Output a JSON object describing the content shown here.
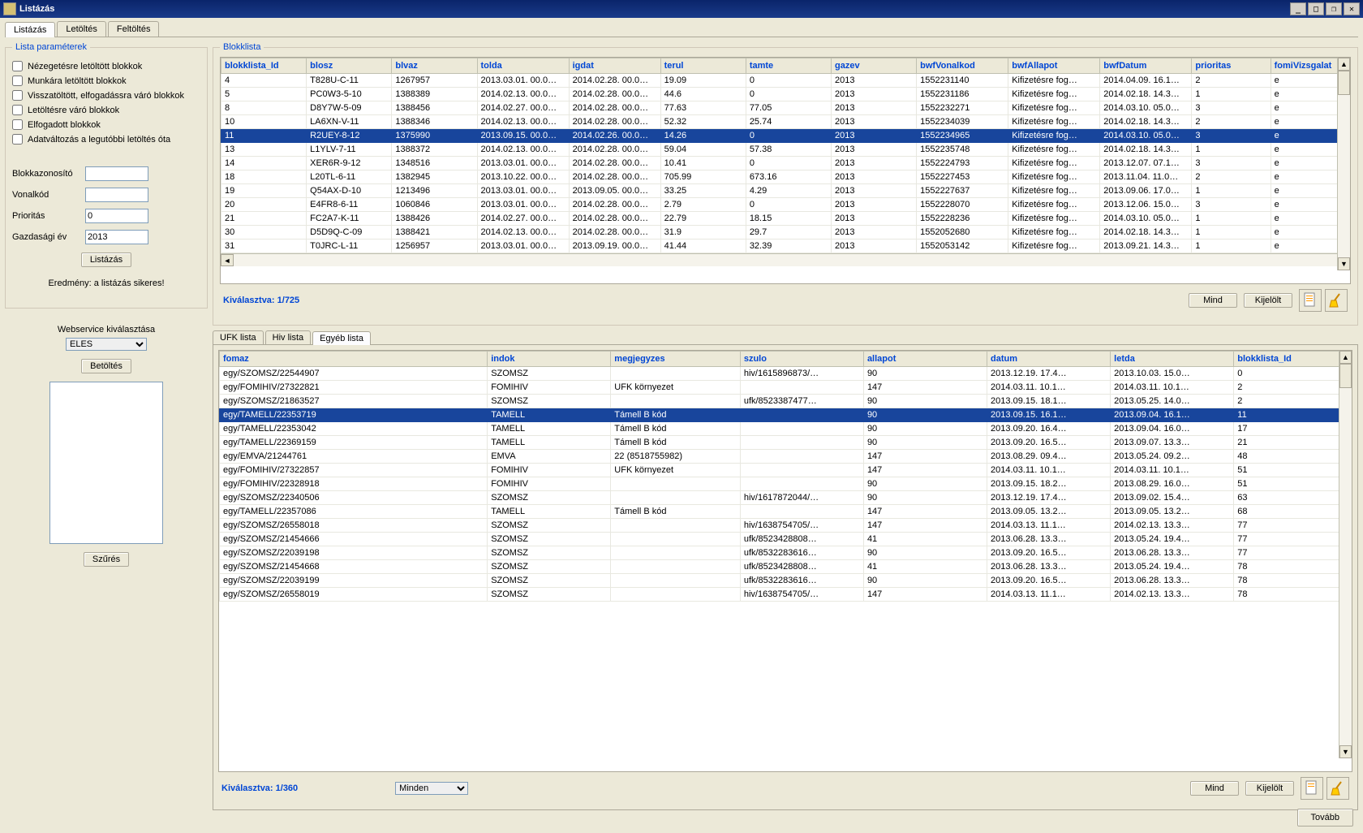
{
  "window": {
    "title": "Listázás",
    "min": "_",
    "max": "□",
    "restore": "❐",
    "close": "✕"
  },
  "mainTabs": [
    "Listázás",
    "Letöltés",
    "Feltöltés"
  ],
  "paramsLegend": "Lista paraméterek",
  "checkboxes": [
    "Nézegetésre letöltött blokkok",
    "Munkára letöltött blokkok",
    "Visszatöltött, elfogadássra váró blokkok",
    "Letöltésre váró blokkok",
    "Elfogadott blokkok",
    "Adatváltozás a legutóbbi letöltés óta"
  ],
  "fields": {
    "blokkazonosito": "Blokkazonosító",
    "vonalkod": "Vonalkód",
    "prioritas": "Prioritás",
    "prioritas_val": "0",
    "gazdev": "Gazdasági év",
    "gazdev_val": "2013"
  },
  "listBtn": "Listázás",
  "statusText": "Eredmény: a listázás sikeres!",
  "wsLabel": "Webservice kiválasztása",
  "wsValue": "ELES",
  "loadBtn": "Betöltés",
  "filterBtn": "Szűrés",
  "blokklistaLegend": "Blokklista",
  "blokkHeaders": [
    "blokklista_Id",
    "blosz",
    "blvaz",
    "tolda",
    "igdat",
    "terul",
    "tamte",
    "gazev",
    "bwfVonalkod",
    "bwfAllapot",
    "bwfDatum",
    "prioritas",
    "fomiVizsgalat"
  ],
  "blokkRows": [
    [
      "4",
      "T828U-C-11",
      "1267957",
      "2013.03.01. 00.0…",
      "2014.02.28. 00.0…",
      "19.09",
      "0",
      "2013",
      "1552231140",
      "Kifizetésre fog…",
      "2014.04.09. 16.1…",
      "2",
      "e"
    ],
    [
      "5",
      "PC0W3-5-10",
      "1388389",
      "2014.02.13. 00.0…",
      "2014.02.28. 00.0…",
      "44.6",
      "0",
      "2013",
      "1552231186",
      "Kifizetésre fog…",
      "2014.02.18. 14.3…",
      "1",
      "e"
    ],
    [
      "8",
      "D8Y7W-5-09",
      "1388456",
      "2014.02.27. 00.0…",
      "2014.02.28. 00.0…",
      "77.63",
      "77.05",
      "2013",
      "1552232271",
      "Kifizetésre fog…",
      "2014.03.10. 05.0…",
      "3",
      "e"
    ],
    [
      "10",
      "LA6XN-V-11",
      "1388346",
      "2014.02.13. 00.0…",
      "2014.02.28. 00.0…",
      "52.32",
      "25.74",
      "2013",
      "1552234039",
      "Kifizetésre fog…",
      "2014.02.18. 14.3…",
      "2",
      "e"
    ],
    [
      "11",
      "R2UEY-8-12",
      "1375990",
      "2013.09.15. 00.0…",
      "2014.02.26. 00.0…",
      "14.26",
      "0",
      "2013",
      "1552234965",
      "Kifizetésre fog…",
      "2014.03.10. 05.0…",
      "3",
      "e"
    ],
    [
      "13",
      "L1YLV-7-11",
      "1388372",
      "2014.02.13. 00.0…",
      "2014.02.28. 00.0…",
      "59.04",
      "57.38",
      "2013",
      "1552235748",
      "Kifizetésre fog…",
      "2014.02.18. 14.3…",
      "1",
      "e"
    ],
    [
      "14",
      "XER6R-9-12",
      "1348516",
      "2013.03.01. 00.0…",
      "2014.02.28. 00.0…",
      "10.41",
      "0",
      "2013",
      "1552224793",
      "Kifizetésre fog…",
      "2013.12.07. 07.1…",
      "3",
      "e"
    ],
    [
      "18",
      "L20TL-6-11",
      "1382945",
      "2013.10.22. 00.0…",
      "2014.02.28. 00.0…",
      "705.99",
      "673.16",
      "2013",
      "1552227453",
      "Kifizetésre fog…",
      "2013.11.04. 11.0…",
      "2",
      "e"
    ],
    [
      "19",
      "Q54AX-D-10",
      "1213496",
      "2013.03.01. 00.0…",
      "2013.09.05. 00.0…",
      "33.25",
      "4.29",
      "2013",
      "1552227637",
      "Kifizetésre fog…",
      "2013.09.06. 17.0…",
      "1",
      "e"
    ],
    [
      "20",
      "E4FR8-6-11",
      "1060846",
      "2013.03.01. 00.0…",
      "2014.02.28. 00.0…",
      "2.79",
      "0",
      "2013",
      "1552228070",
      "Kifizetésre fog…",
      "2013.12.06. 15.0…",
      "3",
      "e"
    ],
    [
      "21",
      "FC2A7-K-11",
      "1388426",
      "2014.02.27. 00.0…",
      "2014.02.28. 00.0…",
      "22.79",
      "18.15",
      "2013",
      "1552228236",
      "Kifizetésre fog…",
      "2014.03.10. 05.0…",
      "1",
      "e"
    ],
    [
      "30",
      "D5D9Q-C-09",
      "1388421",
      "2014.02.13. 00.0…",
      "2014.02.28. 00.0…",
      "31.9",
      "29.7",
      "2013",
      "1552052680",
      "Kifizetésre fog…",
      "2014.02.18. 14.3…",
      "1",
      "e"
    ],
    [
      "31",
      "T0JRC-L-11",
      "1256957",
      "2013.03.01. 00.0…",
      "2013.09.19. 00.0…",
      "41.44",
      "32.39",
      "2013",
      "1552053142",
      "Kifizetésre fog…",
      "2013.09.21. 14.3…",
      "1",
      "e"
    ]
  ],
  "blokkSelectedIdx": 4,
  "blokkSelText": "Kiválasztva: 1/725",
  "mindBtn": "Mind",
  "kijeloltBtn": "Kijelölt",
  "subTabs": [
    "UFK lista",
    "Hiv lista",
    "Egyéb lista"
  ],
  "egyebHeaders": [
    "fomaz",
    "indok",
    "megjegyzes",
    "szulo",
    "allapot",
    "datum",
    "letda",
    "blokklista_Id"
  ],
  "egyebRows": [
    [
      "egy/SZOMSZ/22544907",
      "SZOMSZ",
      "",
      "hiv/1615896873/…",
      "90",
      "2013.12.19. 17.4…",
      "2013.10.03. 15.0…",
      "0"
    ],
    [
      "egy/FOMIHIV/27322821",
      "FOMIHIV",
      "UFK környezet",
      "",
      "147",
      "2014.03.11. 10.1…",
      "2014.03.11. 10.1…",
      "2"
    ],
    [
      "egy/SZOMSZ/21863527",
      "SZOMSZ",
      "",
      "ufk/8523387477…",
      "90",
      "2013.09.15. 18.1…",
      "2013.05.25. 14.0…",
      "2"
    ],
    [
      "egy/TAMELL/22353719",
      "TAMELL",
      "Támell B kód",
      "",
      "90",
      "2013.09.15. 16.1…",
      "2013.09.04. 16.1…",
      "11"
    ],
    [
      "egy/TAMELL/22353042",
      "TAMELL",
      "Támell B kód",
      "",
      "90",
      "2013.09.20. 16.4…",
      "2013.09.04. 16.0…",
      "17"
    ],
    [
      "egy/TAMELL/22369159",
      "TAMELL",
      "Támell B kód",
      "",
      "90",
      "2013.09.20. 16.5…",
      "2013.09.07. 13.3…",
      "21"
    ],
    [
      "egy/EMVA/21244761",
      "EMVA",
      "22 (8518755982)",
      "",
      "147",
      "2013.08.29. 09.4…",
      "2013.05.24. 09.2…",
      "48"
    ],
    [
      "egy/FOMIHIV/27322857",
      "FOMIHIV",
      "UFK környezet",
      "",
      "147",
      "2014.03.11. 10.1…",
      "2014.03.11. 10.1…",
      "51"
    ],
    [
      "egy/FOMIHIV/22328918",
      "FOMIHIV",
      "",
      "",
      "90",
      "2013.09.15. 18.2…",
      "2013.08.29. 16.0…",
      "51"
    ],
    [
      "egy/SZOMSZ/22340506",
      "SZOMSZ",
      "",
      "hiv/1617872044/…",
      "90",
      "2013.12.19. 17.4…",
      "2013.09.02. 15.4…",
      "63"
    ],
    [
      "egy/TAMELL/22357086",
      "TAMELL",
      "Támell B kód",
      "",
      "147",
      "2013.09.05. 13.2…",
      "2013.09.05. 13.2…",
      "68"
    ],
    [
      "egy/SZOMSZ/26558018",
      "SZOMSZ",
      "",
      "hiv/1638754705/…",
      "147",
      "2014.03.13. 11.1…",
      "2014.02.13. 13.3…",
      "77"
    ],
    [
      "egy/SZOMSZ/21454666",
      "SZOMSZ",
      "",
      "ufk/8523428808…",
      "41",
      "2013.06.28. 13.3…",
      "2013.05.24. 19.4…",
      "77"
    ],
    [
      "egy/SZOMSZ/22039198",
      "SZOMSZ",
      "",
      "ufk/8532283616…",
      "90",
      "2013.09.20. 16.5…",
      "2013.06.28. 13.3…",
      "77"
    ],
    [
      "egy/SZOMSZ/21454668",
      "SZOMSZ",
      "",
      "ufk/8523428808…",
      "41",
      "2013.06.28. 13.3…",
      "2013.05.24. 19.4…",
      "78"
    ],
    [
      "egy/SZOMSZ/22039199",
      "SZOMSZ",
      "",
      "ufk/8532283616…",
      "90",
      "2013.09.20. 16.5…",
      "2013.06.28. 13.3…",
      "78"
    ],
    [
      "egy/SZOMSZ/26558019",
      "SZOMSZ",
      "",
      "hiv/1638754705/…",
      "147",
      "2014.03.13. 11.1…",
      "2014.02.13. 13.3…",
      "78"
    ]
  ],
  "egyebSelectedIdx": 3,
  "egyebSelText": "Kiválasztva: 1/360",
  "mindenLabel": "Minden",
  "tovabbBtn": "Tovább"
}
